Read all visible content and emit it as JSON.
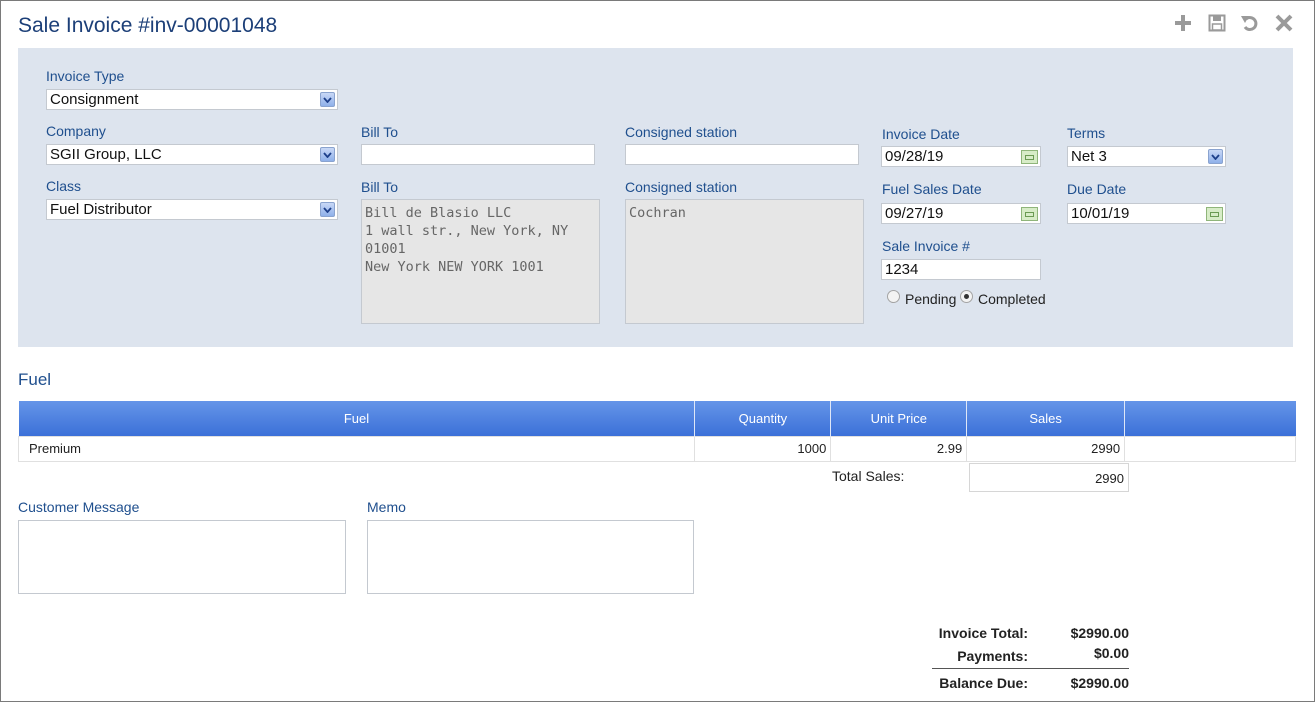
{
  "window": {
    "title": "Sale Invoice #inv-00001048",
    "toolbar": {
      "add": "plus-icon",
      "save": "save-icon",
      "undo": "undo-icon",
      "close": "close-icon"
    }
  },
  "form": {
    "invoice_type": {
      "label": "Invoice Type",
      "value": "Consignment"
    },
    "company": {
      "label": "Company",
      "value": "SGII Group, LLC"
    },
    "class": {
      "label": "Class",
      "value": "Fuel Distributor"
    },
    "bill_to_input": {
      "label": "Bill To",
      "value": ""
    },
    "bill_to_address": {
      "label": "Bill To",
      "lines": "Bill de Blasio LLC\n1 wall str., New York, NY\n01001\nNew York NEW YORK 1001"
    },
    "consigned_station_input": {
      "label": "Consigned station",
      "value": ""
    },
    "consigned_station_text": {
      "label": "Consigned station",
      "value": "Cochran"
    },
    "invoice_date": {
      "label": "Invoice Date",
      "value": "09/28/19"
    },
    "fuel_sales_date": {
      "label": "Fuel Sales Date",
      "value": "09/27/19"
    },
    "sale_invoice_no": {
      "label": "Sale Invoice #",
      "value": "1234"
    },
    "status": {
      "pending_label": "Pending",
      "completed_label": "Completed",
      "selected": "Completed"
    },
    "terms": {
      "label": "Terms",
      "value": "Net 3"
    },
    "due_date": {
      "label": "Due Date",
      "value": "10/01/19"
    }
  },
  "fuel": {
    "section_title": "Fuel",
    "columns": [
      "Fuel",
      "Quantity",
      "Unit Price",
      "Sales",
      ""
    ],
    "rows": [
      {
        "fuel": "Premium",
        "quantity": "1000",
        "unit_price": "2.99",
        "sales": "2990"
      }
    ],
    "total_sales_label": "Total Sales:",
    "total_sales_value": "2990"
  },
  "customer_message": {
    "label": "Customer Message",
    "value": ""
  },
  "memo": {
    "label": "Memo",
    "value": ""
  },
  "totals": {
    "invoice_total_label": "Invoice Total:",
    "invoice_total_value": "$2990.00",
    "payments_label": "Payments:",
    "payments_value": "$0.00",
    "balance_due_label": "Balance Due:",
    "balance_due_value": "$2990.00"
  },
  "colors": {
    "accent": "#1f4f8e",
    "panel": "#dde4ee",
    "header_blue": "#3b70d8"
  }
}
